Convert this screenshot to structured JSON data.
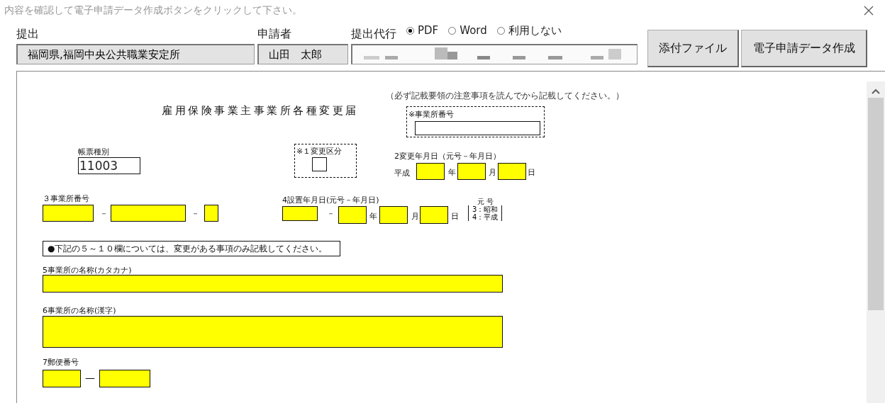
{
  "window": {
    "title": "内容を確認して電子申請データ作成ボタンをクリックして下さい。"
  },
  "header": {
    "submit_to": {
      "label": "提出",
      "value": "福岡県,福岡中央公共職業安定所"
    },
    "applicant": {
      "label": "申請者",
      "value": "山田　太郎"
    },
    "agent": {
      "label": "提出代行"
    },
    "output_options": [
      {
        "label": "PDF",
        "selected": true
      },
      {
        "label": "Word",
        "selected": false
      },
      {
        "label": "利用しない",
        "selected": false
      }
    ],
    "buttons": [
      "添付ファイル",
      "電子申請データ作成"
    ]
  },
  "form": {
    "title": "雇用保険事業主事業所各種変更届",
    "note": "（必ず記載要領の注意事項を読んでから記載してください。）",
    "office_no_box": {
      "label": "※事業所番号"
    },
    "form_type": {
      "label": "帳票種別",
      "value": "11003"
    },
    "change_type": {
      "label": "※１変更区分"
    },
    "change_date": {
      "label": "2変更年月日（元号－年月日）",
      "era": "平成",
      "units": [
        "年",
        "月",
        "日"
      ]
    },
    "office_number": {
      "label": "３事業所番号",
      "separators": [
        "－",
        "－"
      ]
    },
    "established_date": {
      "label": "4設置年月日(元号－年月日)",
      "separator": "－",
      "units": [
        "年",
        "月",
        "日"
      ],
      "era_legend": {
        "heading": "元 号",
        "items": [
          "3：昭和",
          "4：平成"
        ]
      }
    },
    "notice": "●下記の５～１０欄については、変更がある事項のみ記載してください。",
    "name_kana": {
      "label": "5事業所の名称(カタカナ)"
    },
    "name_kanji": {
      "label": "6事業所の名称(漢字)"
    },
    "postal_code": {
      "label": "7郵便番号",
      "separator": "—"
    }
  }
}
